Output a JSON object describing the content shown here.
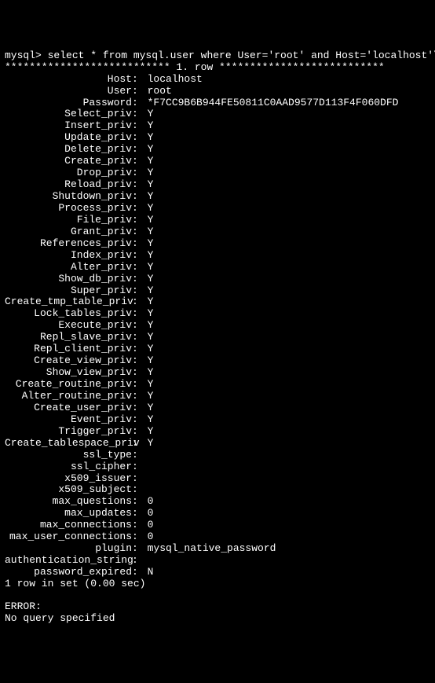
{
  "prompt": "mysql> select * from mysql.user where User='root' and Host='localhost'\\G;",
  "row_separator": "*************************** 1. row ***************************",
  "fields": [
    {
      "label": "Host",
      "value": "localhost"
    },
    {
      "label": "User",
      "value": "root"
    },
    {
      "label": "Password",
      "value": "*F7CC9B6B944FE50811C0AAD9577D113F4F060DFD"
    },
    {
      "label": "Select_priv",
      "value": "Y"
    },
    {
      "label": "Insert_priv",
      "value": "Y"
    },
    {
      "label": "Update_priv",
      "value": "Y"
    },
    {
      "label": "Delete_priv",
      "value": "Y"
    },
    {
      "label": "Create_priv",
      "value": "Y"
    },
    {
      "label": "Drop_priv",
      "value": "Y"
    },
    {
      "label": "Reload_priv",
      "value": "Y"
    },
    {
      "label": "Shutdown_priv",
      "value": "Y"
    },
    {
      "label": "Process_priv",
      "value": "Y"
    },
    {
      "label": "File_priv",
      "value": "Y"
    },
    {
      "label": "Grant_priv",
      "value": "Y"
    },
    {
      "label": "References_priv",
      "value": "Y"
    },
    {
      "label": "Index_priv",
      "value": "Y"
    },
    {
      "label": "Alter_priv",
      "value": "Y"
    },
    {
      "label": "Show_db_priv",
      "value": "Y"
    },
    {
      "label": "Super_priv",
      "value": "Y"
    },
    {
      "label": "Create_tmp_table_priv",
      "value": "Y"
    },
    {
      "label": "Lock_tables_priv",
      "value": "Y"
    },
    {
      "label": "Execute_priv",
      "value": "Y"
    },
    {
      "label": "Repl_slave_priv",
      "value": "Y"
    },
    {
      "label": "Repl_client_priv",
      "value": "Y"
    },
    {
      "label": "Create_view_priv",
      "value": "Y"
    },
    {
      "label": "Show_view_priv",
      "value": "Y"
    },
    {
      "label": "Create_routine_priv",
      "value": "Y"
    },
    {
      "label": "Alter_routine_priv",
      "value": "Y"
    },
    {
      "label": "Create_user_priv",
      "value": "Y"
    },
    {
      "label": "Event_priv",
      "value": "Y"
    },
    {
      "label": "Trigger_priv",
      "value": "Y"
    },
    {
      "label": "Create_tablespace_priv",
      "value": "Y"
    },
    {
      "label": "ssl_type",
      "value": ""
    },
    {
      "label": "ssl_cipher",
      "value": ""
    },
    {
      "label": "x509_issuer",
      "value": ""
    },
    {
      "label": "x509_subject",
      "value": ""
    },
    {
      "label": "max_questions",
      "value": "0"
    },
    {
      "label": "max_updates",
      "value": "0"
    },
    {
      "label": "max_connections",
      "value": "0"
    },
    {
      "label": "max_user_connections",
      "value": "0"
    },
    {
      "label": "plugin",
      "value": "mysql_native_password"
    },
    {
      "label": "authentication_string",
      "value": ""
    },
    {
      "label": "password_expired",
      "value": "N"
    }
  ],
  "rows_summary": "1 row in set (0.00 sec)",
  "error_label": "ERROR:",
  "error_msg": "No query specified"
}
